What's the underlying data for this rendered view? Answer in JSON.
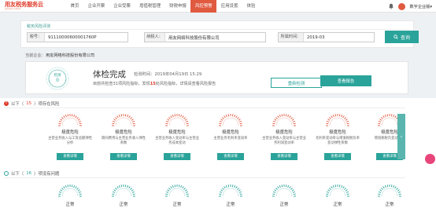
{
  "app": {
    "logo_text": "用友税务服务云",
    "logo_sub": "yonyou cloud",
    "user_name": "数字企业版▾"
  },
  "nav": [
    "首页",
    "企业开票",
    "企业受票",
    "增值税管理",
    "财税申报",
    "风控预警",
    "应用设置",
    "体验"
  ],
  "search": {
    "section_title": "税务风险评测",
    "tax_label": "税号：",
    "tax_value": "91110000600001760P",
    "name_label": "纳税人：",
    "name_value": "用友网络科技股份有限公司",
    "period_label": "所属时间：",
    "period_value": "2019-03",
    "query_label": "查询"
  },
  "company": {
    "label": "当前企业：",
    "value": "用友网络科技股份有限公司"
  },
  "result": {
    "gauge_label": "检测",
    "gauge_score": "0",
    "title": "体检完成",
    "time_text": "检测时间：2019年04月19日 15:29",
    "desc_a": "目前共检查31项风险指标，发现",
    "desc_risk": "15",
    "desc_b": "处风险指标，详情请查看风险报告",
    "recheck_label": "重新检测",
    "report_label": "查看报告"
  },
  "risk": {
    "head_prefix": "以下（",
    "count": "15",
    "head_suffix": "）项存在风险",
    "detail_label": "查看详情",
    "items": [
      {
        "level": "极度危险",
        "desc": "主营业务收入与工资总额弹性分析"
      },
      {
        "level": "极度危险",
        "desc": "期间费用与主营业务收入弹性系数"
      },
      {
        "level": "极度危险",
        "desc": "主营业务收入变动率与主营业务成本变动"
      },
      {
        "level": "极度危险",
        "desc": "主营业务毛利率变动率"
      },
      {
        "level": "极度危险",
        "desc": "主营业务收入变动率与主营业务利润变动率"
      },
      {
        "level": "极度危险",
        "desc": "毛利率变动率与增值税税负率变动弹性系数"
      },
      {
        "level": "极度危险",
        "desc": "增值税税负变动异常"
      }
    ],
    "next": "›"
  },
  "ok": {
    "head_prefix": "以下（",
    "count": "16",
    "head_suffix": "）项没有问题",
    "items": [
      {
        "level": "正常"
      },
      {
        "level": "正常"
      },
      {
        "level": "正常"
      },
      {
        "level": "正常"
      },
      {
        "level": "正常"
      },
      {
        "level": "正常"
      },
      {
        "level": "正常"
      }
    ]
  },
  "colors": {
    "brand": "#e03a2a",
    "accent": "#2aa39a",
    "gauge_red": "#e05a40"
  }
}
